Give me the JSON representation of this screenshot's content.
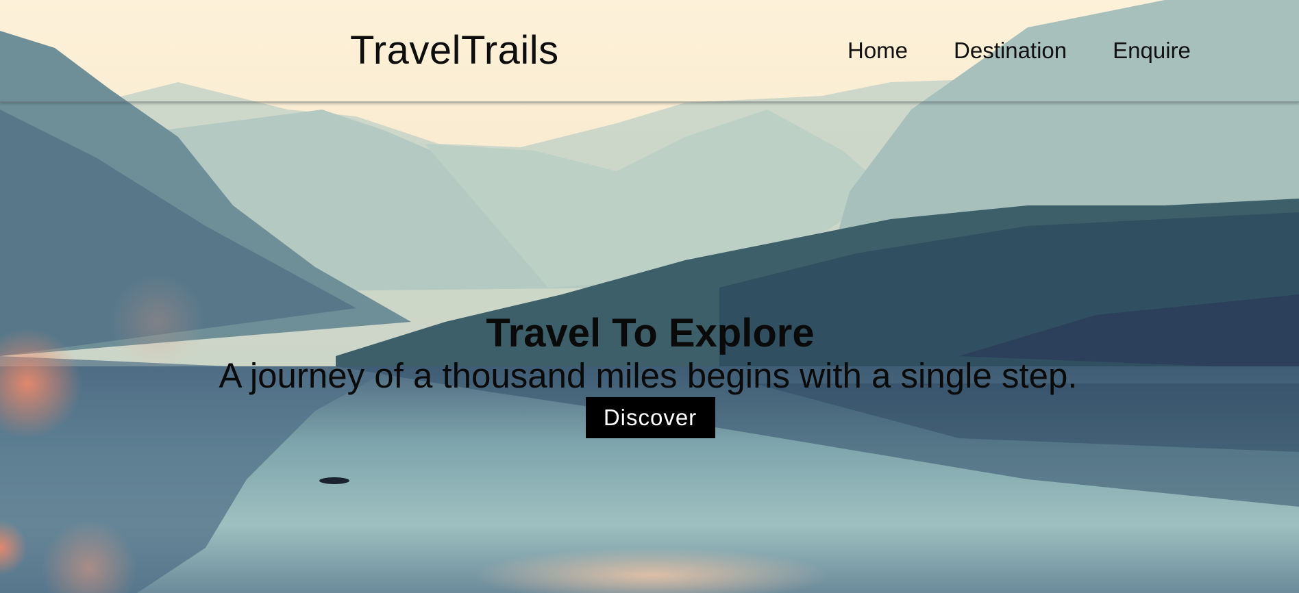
{
  "header": {
    "brand": "TravelTrails",
    "nav": [
      {
        "label": "Home"
      },
      {
        "label": "Destination"
      },
      {
        "label": "Enquire"
      }
    ]
  },
  "hero": {
    "title": "Travel To Explore",
    "subtitle": "A journey of a thousand miles begins with a single step.",
    "cta_label": "Discover"
  },
  "colors": {
    "cta_background": "#000000",
    "cta_text": "#ffffff",
    "text": "#0a0a0a"
  }
}
